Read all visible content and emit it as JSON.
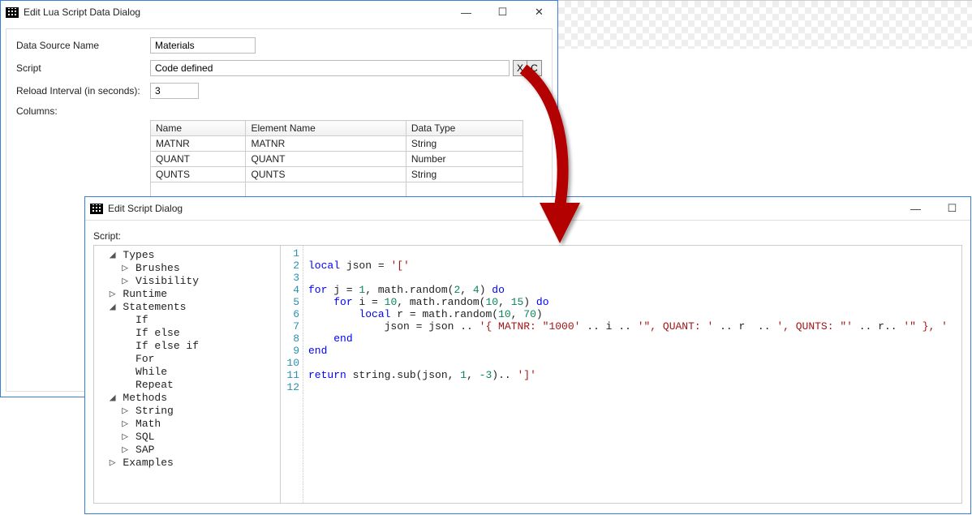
{
  "dialog1": {
    "title": "Edit Lua Script Data Dialog",
    "data_source_label": "Data Source Name",
    "data_source_value": "Materials",
    "script_label": "Script",
    "script_value": "Code defined",
    "x_btn": "X",
    "c_btn": "C",
    "reload_label": "Reload Interval (in seconds):",
    "reload_value": "3",
    "columns_label": "Columns:",
    "table": {
      "headers": [
        "Name",
        "Element Name",
        "Data Type"
      ],
      "rows": [
        [
          "MATNR",
          "MATNR",
          "String"
        ],
        [
          "QUANT",
          "QUANT",
          "Number"
        ],
        [
          "QUNTS",
          "QUNTS",
          "String"
        ]
      ]
    }
  },
  "dialog2": {
    "title": "Edit Script Dialog",
    "script_label": "Script:",
    "tree": [
      {
        "d": 0,
        "exp": "open",
        "label": "Types"
      },
      {
        "d": 1,
        "exp": "closed",
        "label": "Brushes"
      },
      {
        "d": 1,
        "exp": "closed",
        "label": "Visibility"
      },
      {
        "d": 0,
        "exp": "closed",
        "label": "Runtime"
      },
      {
        "d": 0,
        "exp": "open",
        "label": "Statements"
      },
      {
        "d": 1,
        "exp": "none",
        "label": "If"
      },
      {
        "d": 1,
        "exp": "none",
        "label": "If else"
      },
      {
        "d": 1,
        "exp": "none",
        "label": "If else if"
      },
      {
        "d": 1,
        "exp": "none",
        "label": "For"
      },
      {
        "d": 1,
        "exp": "none",
        "label": "While"
      },
      {
        "d": 1,
        "exp": "none",
        "label": "Repeat"
      },
      {
        "d": 0,
        "exp": "open",
        "label": "Methods"
      },
      {
        "d": 1,
        "exp": "closed",
        "label": "String"
      },
      {
        "d": 1,
        "exp": "closed",
        "label": "Math"
      },
      {
        "d": 1,
        "exp": "closed",
        "label": "SQL"
      },
      {
        "d": 1,
        "exp": "closed",
        "label": "SAP"
      },
      {
        "d": 0,
        "exp": "closed",
        "label": "Examples"
      }
    ],
    "code": [
      {
        "n": 1,
        "tokens": []
      },
      {
        "n": 2,
        "tokens": [
          [
            "kw",
            "local"
          ],
          [
            "",
            " json = "
          ],
          [
            "str",
            "'['"
          ]
        ]
      },
      {
        "n": 3,
        "tokens": []
      },
      {
        "n": 4,
        "tokens": [
          [
            "kw",
            "for"
          ],
          [
            "",
            " j = "
          ],
          [
            "num",
            "1"
          ],
          [
            "",
            ", math.random("
          ],
          [
            "num",
            "2"
          ],
          [
            "",
            ", "
          ],
          [
            "num",
            "4"
          ],
          [
            "",
            ") "
          ],
          [
            "kw",
            "do"
          ]
        ]
      },
      {
        "n": 5,
        "tokens": [
          [
            "",
            "    "
          ],
          [
            "kw",
            "for"
          ],
          [
            "",
            " i = "
          ],
          [
            "num",
            "10"
          ],
          [
            "",
            ", math.random("
          ],
          [
            "num",
            "10"
          ],
          [
            "",
            ", "
          ],
          [
            "num",
            "15"
          ],
          [
            "",
            ") "
          ],
          [
            "kw",
            "do"
          ]
        ]
      },
      {
        "n": 6,
        "tokens": [
          [
            "",
            "        "
          ],
          [
            "kw",
            "local"
          ],
          [
            "",
            " r = math.random("
          ],
          [
            "num",
            "10"
          ],
          [
            "",
            ", "
          ],
          [
            "num",
            "70"
          ],
          [
            "",
            ")"
          ]
        ]
      },
      {
        "n": 7,
        "tokens": [
          [
            "",
            "            json = json .. "
          ],
          [
            "str",
            "'{ MATNR: \"1000'"
          ],
          [
            "",
            " .. i .. "
          ],
          [
            "str",
            "'\", QUANT: '"
          ],
          [
            "",
            " .. r  .. "
          ],
          [
            "str",
            "', QUNTS: \"'"
          ],
          [
            "",
            " .. r.. "
          ],
          [
            "str",
            "'\" }, '"
          ]
        ]
      },
      {
        "n": 8,
        "tokens": [
          [
            "",
            "    "
          ],
          [
            "kw",
            "end"
          ]
        ]
      },
      {
        "n": 9,
        "tokens": [
          [
            "kw",
            "end"
          ]
        ]
      },
      {
        "n": 10,
        "tokens": []
      },
      {
        "n": 11,
        "tokens": [
          [
            "kw",
            "return"
          ],
          [
            "",
            " string.sub(json, "
          ],
          [
            "num",
            "1"
          ],
          [
            "",
            ", "
          ],
          [
            "num",
            "-3"
          ],
          [
            "",
            ").. "
          ],
          [
            "str",
            "']'"
          ]
        ]
      },
      {
        "n": 12,
        "tokens": []
      }
    ]
  },
  "win_controls": {
    "min": "—",
    "max": "☐",
    "close": "✕"
  }
}
